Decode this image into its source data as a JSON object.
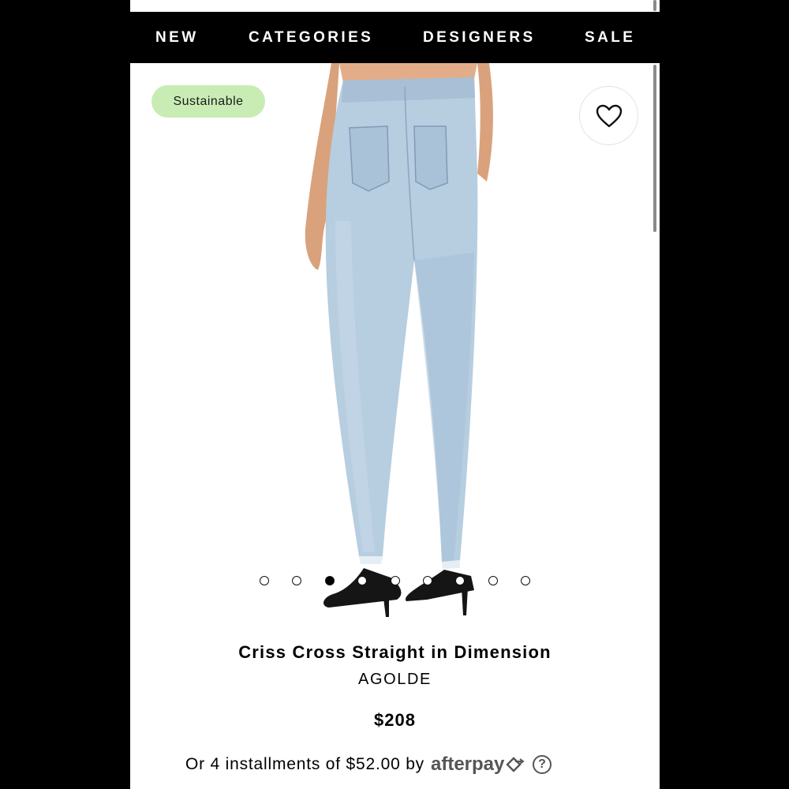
{
  "nav": {
    "items": [
      {
        "label": "NEW"
      },
      {
        "label": "CATEGORIES"
      },
      {
        "label": "DESIGNERS"
      },
      {
        "label": "SALE"
      }
    ]
  },
  "badge": {
    "label": "Sustainable"
  },
  "favorite": {
    "icon": "heart-icon"
  },
  "gallery": {
    "total_images": 9,
    "active_index": 3
  },
  "product": {
    "title": "Criss Cross Straight in Dimension",
    "brand": "AGOLDE",
    "price": "$208"
  },
  "payment": {
    "text": "Or 4 installments of $52.00 by",
    "provider": "afterpay",
    "help_icon": "?"
  },
  "colors": {
    "nav_bg": "#000000",
    "badge_bg": "#c9ecb4",
    "denim": "#b7cde0"
  }
}
